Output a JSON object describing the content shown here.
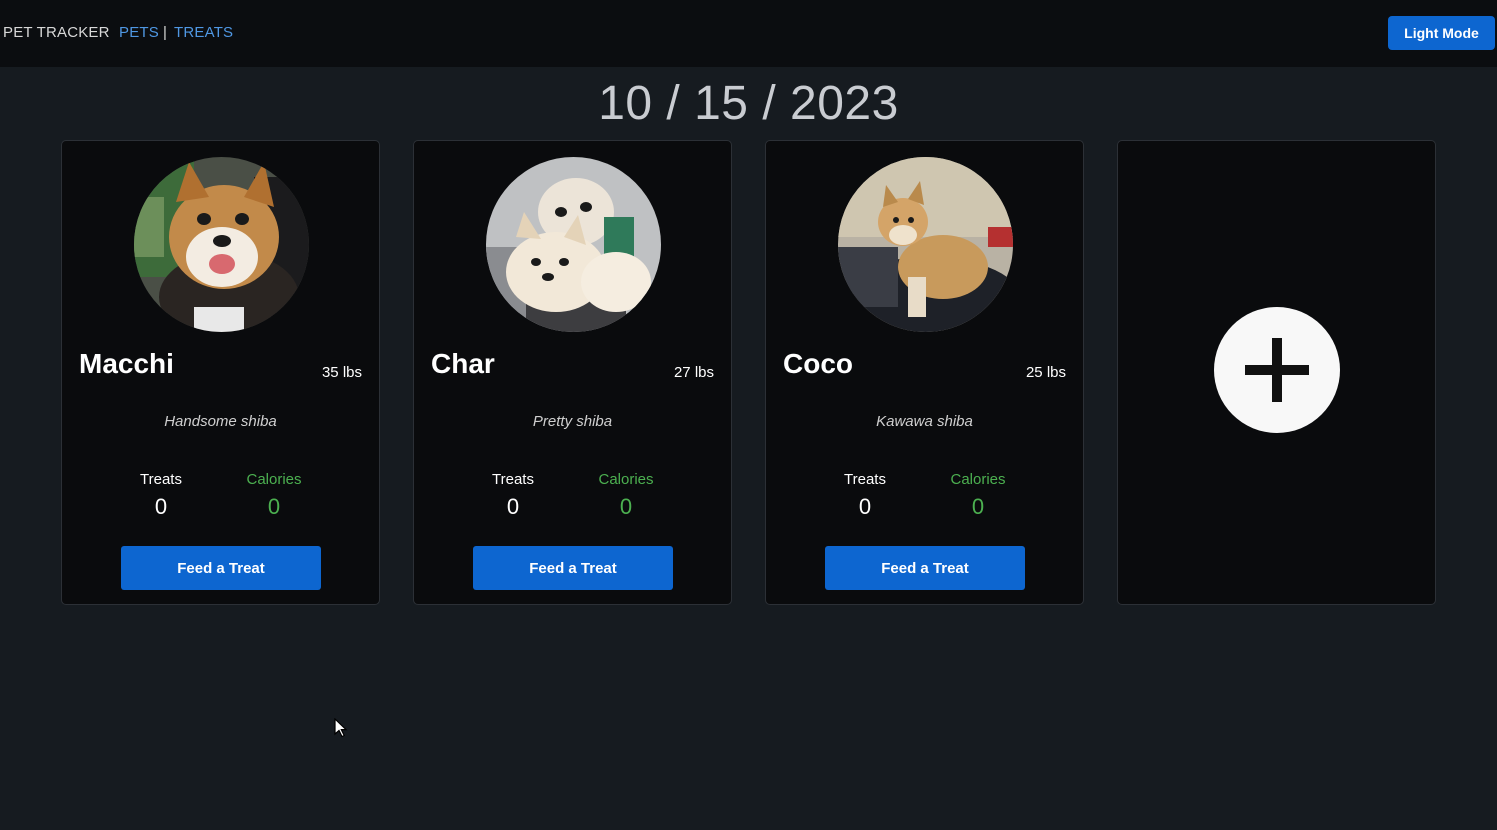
{
  "nav": {
    "brand": "PET TRACKER",
    "links": [
      "PETS",
      "TREATS"
    ],
    "separator": "|",
    "mode_button": "Light Mode"
  },
  "date": "10 / 15 / 2023",
  "pets": [
    {
      "name": "Macchi",
      "weight": "35 lbs",
      "description": "Handsome shiba",
      "treats_label": "Treats",
      "treats": "0",
      "calories_label": "Calories",
      "calories": "0",
      "button": "Feed a Treat"
    },
    {
      "name": "Char",
      "weight": "27 lbs",
      "description": "Pretty shiba",
      "treats_label": "Treats",
      "treats": "0",
      "calories_label": "Calories",
      "calories": "0",
      "button": "Feed a Treat"
    },
    {
      "name": "Coco",
      "weight": "25 lbs",
      "description": "Kawawa shiba",
      "treats_label": "Treats",
      "treats": "0",
      "calories_label": "Calories",
      "calories": "0",
      "button": "Feed a Treat"
    }
  ],
  "add_card": {
    "icon": "plus-icon"
  },
  "colors": {
    "accent": "#0d66d0",
    "link": "#4f97e3",
    "calories": "#4cb050",
    "background": "#161b20"
  }
}
